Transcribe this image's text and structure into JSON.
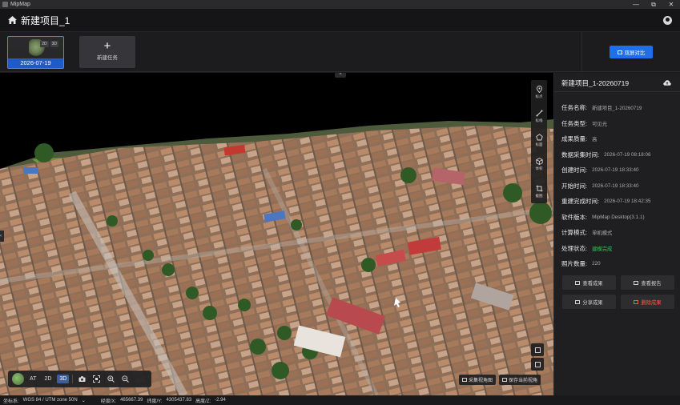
{
  "window": {
    "title": "MipMap",
    "controls": [
      "—",
      "⧉",
      "✕"
    ]
  },
  "header": {
    "project_title": "新建项目_1"
  },
  "tasks": {
    "cards": [
      {
        "date": "2026-07-19",
        "badges": [
          "2D",
          "3D"
        ]
      }
    ],
    "new_task_label": "新建任务",
    "new_task_plus": "+"
  },
  "compare_button": {
    "label": "双屏对比"
  },
  "viewport": {
    "tools": [
      {
        "label": "标点",
        "icon": "pin-icon"
      },
      {
        "label": "标线",
        "icon": "line-icon"
      },
      {
        "label": "标面",
        "icon": "polygon-icon"
      },
      {
        "label": "体积",
        "icon": "volume-icon"
      },
      {
        "label": "截图",
        "icon": "crop-icon"
      }
    ],
    "modes": [
      "AT",
      "2D",
      "3D"
    ],
    "active_mode": "3D",
    "bottom_buttons": [
      {
        "label": "采集视角图"
      },
      {
        "label": "保存当前视角"
      }
    ],
    "collapse_top": "^",
    "collapse_left": "‹"
  },
  "statusbar": {
    "crs_label": "坐标系:",
    "crs_value": "WGS 84 / UTM zone 50N",
    "crs_caret": "⌄",
    "x_label": "经度/X:",
    "x_value": "465667.39",
    "y_label": "纬度/Y:",
    "y_value": "4305437.83",
    "z_label": "高度/Z:",
    "z_value": "-2.94"
  },
  "panel": {
    "title": "新建项目_1-20260719",
    "fields": [
      {
        "key": "任务名称:",
        "value": "新建项目_1-20260719",
        "status": "normal"
      },
      {
        "key": "任务类型:",
        "value": "可见光",
        "status": "normal"
      },
      {
        "key": "成果质量:",
        "value": "高",
        "status": "normal"
      },
      {
        "key": "数据采集时间:",
        "value": "2026-07-19 08:18:06",
        "status": "normal"
      },
      {
        "key": "创建时间:",
        "value": "2026-07-19 18:33:40",
        "status": "normal"
      },
      {
        "key": "开始时间:",
        "value": "2026-07-19 18:33:40",
        "status": "normal"
      },
      {
        "key": "重建完成时间:",
        "value": "2026-07-19 18:42:35",
        "status": "normal"
      },
      {
        "key": "软件版本:",
        "value": "MipMap Desktop(3.1.1)",
        "status": "normal"
      },
      {
        "key": "计算模式:",
        "value": "单机模式",
        "status": "normal"
      },
      {
        "key": "处理状态:",
        "value": "建模完成",
        "status": "ok"
      },
      {
        "key": "照片数量:",
        "value": "220",
        "status": "normal"
      }
    ],
    "actions": [
      {
        "label": "查看成果",
        "name": "view-results-button"
      },
      {
        "label": "查看报告",
        "name": "view-report-button"
      },
      {
        "label": "分享成果",
        "name": "share-results-button"
      },
      {
        "label": "删除成果",
        "name": "delete-results-button"
      }
    ]
  },
  "colors": {
    "accent": "#1f6fe8",
    "success": "#38c25a",
    "danger": "#ff5a40",
    "panel_bg": "#1f1f21"
  }
}
